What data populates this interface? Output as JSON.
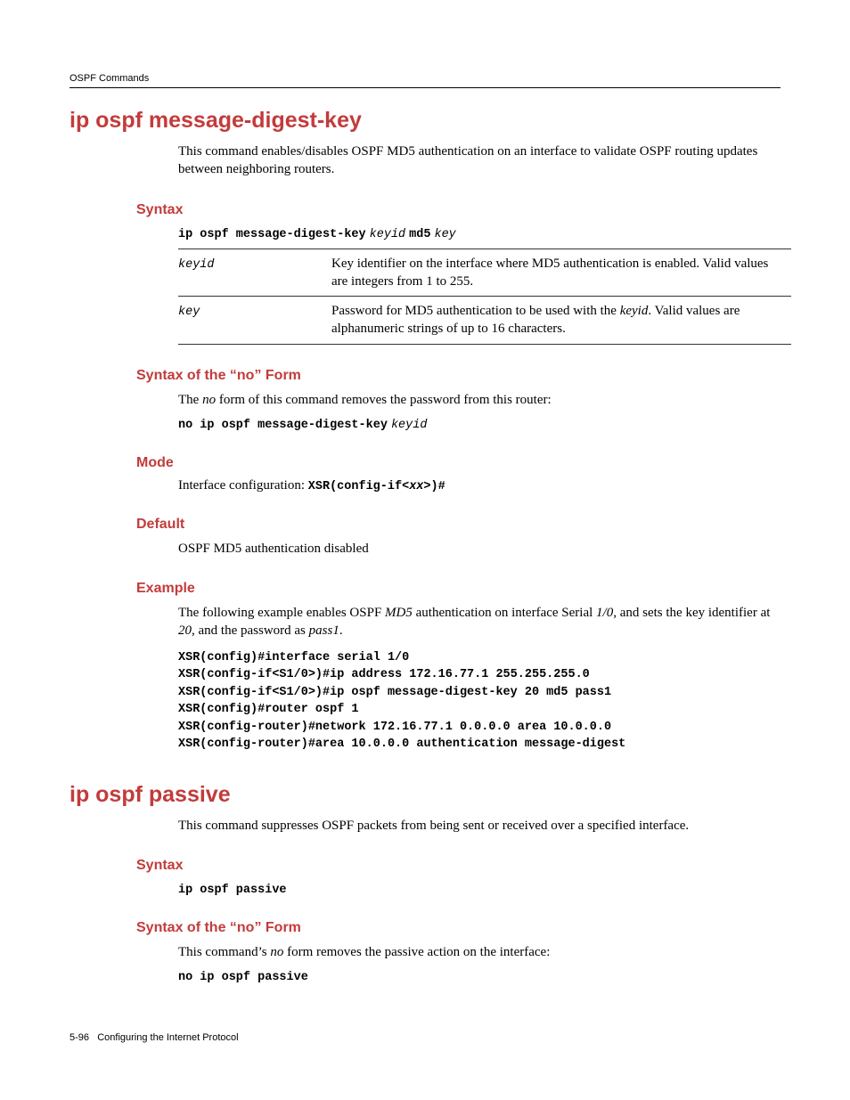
{
  "running_header": "OSPF Commands",
  "cmd1": {
    "title": "ip ospf message-digest-key",
    "description": "This command enables/disables OSPF MD5 authentication on an interface to validate OSPF routing updates between neighboring routers.",
    "syntax": {
      "heading": "Syntax",
      "cmd_bold": "ip ospf message-digest-key",
      "arg1": "keyid",
      "mid_bold": "md5",
      "arg2": "key",
      "params": {
        "keyid": {
          "name": "keyid",
          "desc": "Key identifier on the interface where MD5 authentication is enabled. Valid values are integers from 1 to 255."
        },
        "key": {
          "name": "key",
          "desc_pre": "Password for MD5 authentication to be used with the ",
          "desc_em": "keyid",
          "desc_post": ". Valid values are alphanumeric strings of up to 16 characters."
        }
      }
    },
    "no_form": {
      "heading": "Syntax of the “no” Form",
      "desc_pre": "The ",
      "desc_em": "no",
      "desc_post": " form of this command removes the password from this router:",
      "cmd_bold": "no ip ospf message-digest-key",
      "cmd_arg": "keyid"
    },
    "mode": {
      "heading": "Mode",
      "text": "Interface configuration: ",
      "prompt_pre": "XSR(config-if<",
      "prompt_em": "xx",
      "prompt_post": ">)#"
    },
    "default": {
      "heading": "Default",
      "text": "OSPF MD5 authentication disabled"
    },
    "example": {
      "heading": "Example",
      "intro_pre": "The following example enables OSPF ",
      "intro_em1": "MD5",
      "intro_mid1": " authentication on interface Serial ",
      "intro_em2": "1/0",
      "intro_mid2": ", and sets the key identifier at ",
      "intro_em3": "20",
      "intro_mid3": ", and the password as ",
      "intro_em4": "pass1",
      "intro_post": ".",
      "code": "XSR(config)#interface serial 1/0\nXSR(config-if<S1/0>)#ip address 172.16.77.1 255.255.255.0\nXSR(config-if<S1/0>)#ip ospf message-digest-key 20 md5 pass1\nXSR(config)#router ospf 1\nXSR(config-router)#network 172.16.77.1 0.0.0.0 area 10.0.0.0\nXSR(config-router)#area 10.0.0.0 authentication message-digest"
    }
  },
  "cmd2": {
    "title": "ip ospf passive",
    "description": "This command suppresses OSPF packets from being sent or received over a specified interface.",
    "syntax": {
      "heading": "Syntax",
      "cmd_bold": "ip ospf passive"
    },
    "no_form": {
      "heading": "Syntax of the “no” Form",
      "desc_pre": "This command’s ",
      "desc_em": "no",
      "desc_post": " form removes the passive action on the interface:",
      "cmd_bold": "no ip ospf passive"
    }
  },
  "footer": {
    "page": "5-96",
    "chapter": "Configuring the Internet Protocol"
  }
}
